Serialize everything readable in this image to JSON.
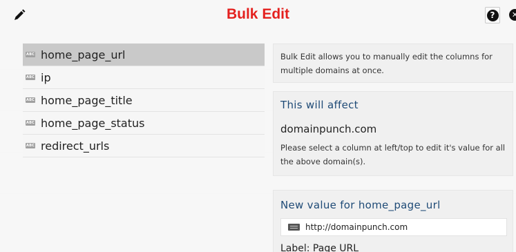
{
  "modal": {
    "title": "Bulk Edit",
    "colors": {
      "title": "#e4211f",
      "heading": "#1e4a76",
      "selected_row": "#c9c9c9"
    },
    "icons": {
      "edit": "pencil-icon",
      "help": "question-circle-icon",
      "close": "close-circle-icon",
      "column_type": "abc-icon",
      "input": "keyboard-icon"
    },
    "help_glyph": "?",
    "close_glyph": "✕"
  },
  "columns": [
    {
      "badge": "ABC",
      "label": "home_page_url",
      "selected": true
    },
    {
      "badge": "ABC",
      "label": "ip",
      "selected": false
    },
    {
      "badge": "ABC",
      "label": "home_page_title",
      "selected": false
    },
    {
      "badge": "ABC",
      "label": "home_page_status",
      "selected": false
    },
    {
      "badge": "ABC",
      "label": "redirect_urls",
      "selected": false
    }
  ],
  "info": {
    "text": "Bulk Edit allows you to manually edit the columns for multiple domains at once."
  },
  "affect": {
    "heading": "This will affect",
    "domain": "domainpunch.com",
    "note": "Please select a column at left/top to edit it's value for all the above domain(s)."
  },
  "new_value": {
    "heading": "New value for home_page_url",
    "value": "http://domainpunch.com",
    "label": "Label: Page URL"
  }
}
